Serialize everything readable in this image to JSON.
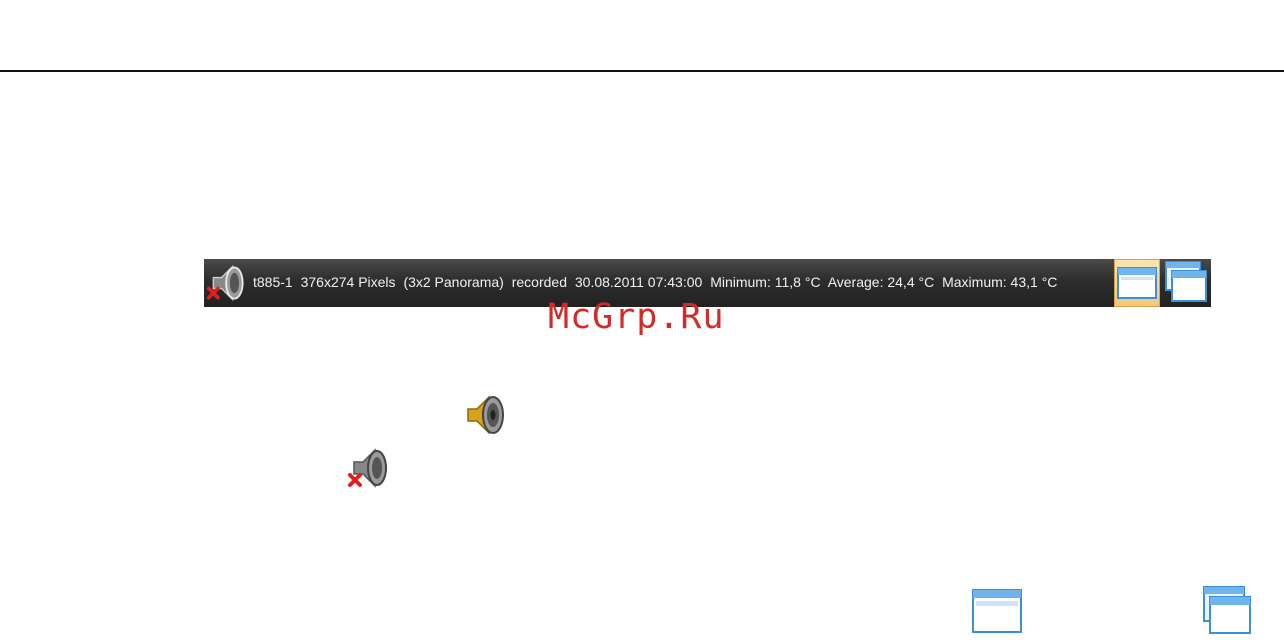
{
  "statusbar": {
    "camera": "t885-1",
    "resolution": "376x274 Pixels",
    "mode": "(3x2 Panorama)",
    "recorded_label": "recorded",
    "recorded_value": "30.08.2011 07:43:00",
    "minimum": "Minimum: 11,8 °C",
    "average": "Average: 24,4 °C",
    "maximum": "Maximum: 43,1 °C",
    "icons": {
      "sound": "speaker-muted-icon",
      "single_window": "single-window-icon",
      "multi_window": "multiple-windows-icon"
    }
  },
  "legend": {
    "sound_on_icon": "speaker-on-icon",
    "sound_off_icon": "speaker-muted-icon",
    "single_window_icon": "single-window-icon",
    "multi_window_icon": "multiple-windows-icon"
  },
  "watermark": "McGrp.Ru",
  "colors": {
    "statusbar_bg": "#2d2d2d",
    "statusbar_text": "#f2f2f2",
    "watermark": "#d42a2a",
    "window_blue": "#3a8fd6",
    "active_highlight": "#f2c77a"
  }
}
